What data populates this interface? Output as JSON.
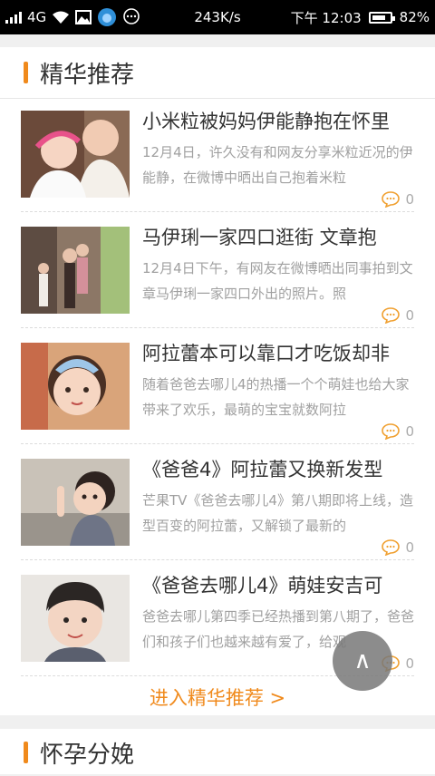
{
  "status_bar": {
    "network": "4G",
    "speed": "243K/s",
    "time": "下午 12:03",
    "battery": "82%",
    "battery_level": 0.82
  },
  "section1": {
    "title": "精华推荐",
    "items": [
      {
        "title": "小米粒被妈妈伊能静抱在怀里",
        "desc": "12月4日，许久没有和网友分享米粒近况的伊能静，在微博中晒出自己抱着米粒",
        "comments": "0"
      },
      {
        "title": "马伊琍一家四口逛街 文章抱",
        "desc": "12月4日下午，有网友在微博晒出同事拍到文章马伊琍一家四口外出的照片。照",
        "comments": "0"
      },
      {
        "title": "阿拉蕾本可以靠口才吃饭却非",
        "desc": "随着爸爸去哪儿4的热播一个个萌娃也给大家带来了欢乐，最萌的宝宝就数阿拉",
        "comments": "0"
      },
      {
        "title": "《爸爸4》阿拉蕾又换新发型",
        "desc": "芒果TV《爸爸去哪儿4》第八期即将上线，造型百变的阿拉蕾，又解锁了最新的",
        "comments": "0"
      },
      {
        "title": "《爸爸去哪儿4》萌娃安吉可",
        "desc": "爸爸去哪儿第四季已经热播到第八期了，爸爸们和孩子们也越来越有爱了，给观",
        "comments": "0"
      }
    ],
    "more_link": "进入精华推荐 >"
  },
  "section2": {
    "title": "怀孕分娩"
  },
  "fab": {
    "label": "∧"
  }
}
